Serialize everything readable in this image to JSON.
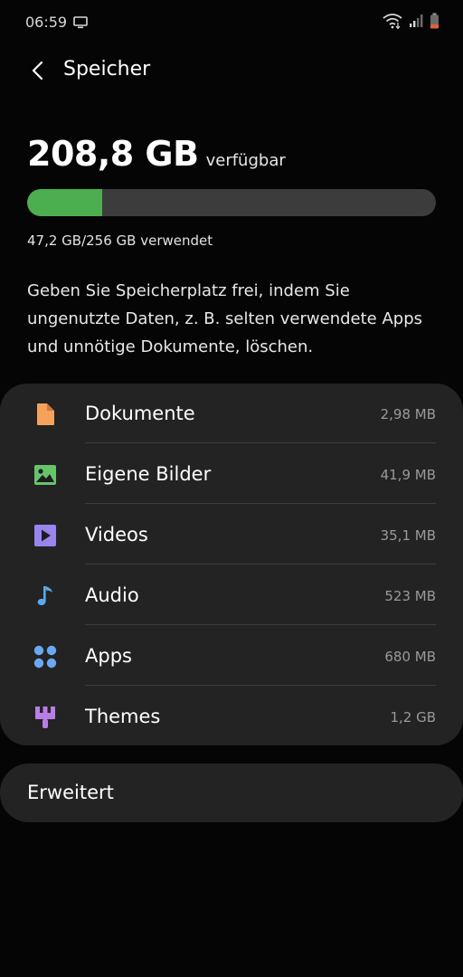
{
  "status_bar": {
    "time": "06:59",
    "icons": [
      "cast-icon",
      "wifi-icon",
      "signal-icon",
      "battery-icon"
    ]
  },
  "header": {
    "title": "Speicher",
    "back_icon": "back-arrow-icon"
  },
  "storage": {
    "free_value": "208,8 GB",
    "free_label": "verfügbar",
    "used_text": "47,2 GB/256 GB verwendet",
    "used_fraction": 0.184,
    "bar_fill_color": "#4cae4f",
    "bar_track_color": "#3c3c3c"
  },
  "description": "Geben Sie Speicherplatz frei, indem Sie ungenutzte Daten, z. B. selten verwendete Apps und unnötige Dokumente, löschen.",
  "categories": [
    {
      "label": "Dokumente",
      "size": "2,98 MB",
      "icon": "document-icon",
      "color": "#f5a25d"
    },
    {
      "label": "Eigene Bilder",
      "size": "41,9 MB",
      "icon": "image-icon",
      "color": "#66c56a"
    },
    {
      "label": "Videos",
      "size": "35,1 MB",
      "icon": "video-play-icon",
      "color": "#9a84ee"
    },
    {
      "label": "Audio",
      "size": "523 MB",
      "icon": "music-note-icon",
      "color": "#5aa9ee"
    },
    {
      "label": "Apps",
      "size": "680 MB",
      "icon": "apps-grid-icon",
      "color": "#6aa8f2"
    },
    {
      "label": "Themes",
      "size": "1,2 GB",
      "icon": "paint-brush-icon",
      "color": "#b97ee6"
    }
  ],
  "advanced": {
    "label": "Erweitert"
  }
}
